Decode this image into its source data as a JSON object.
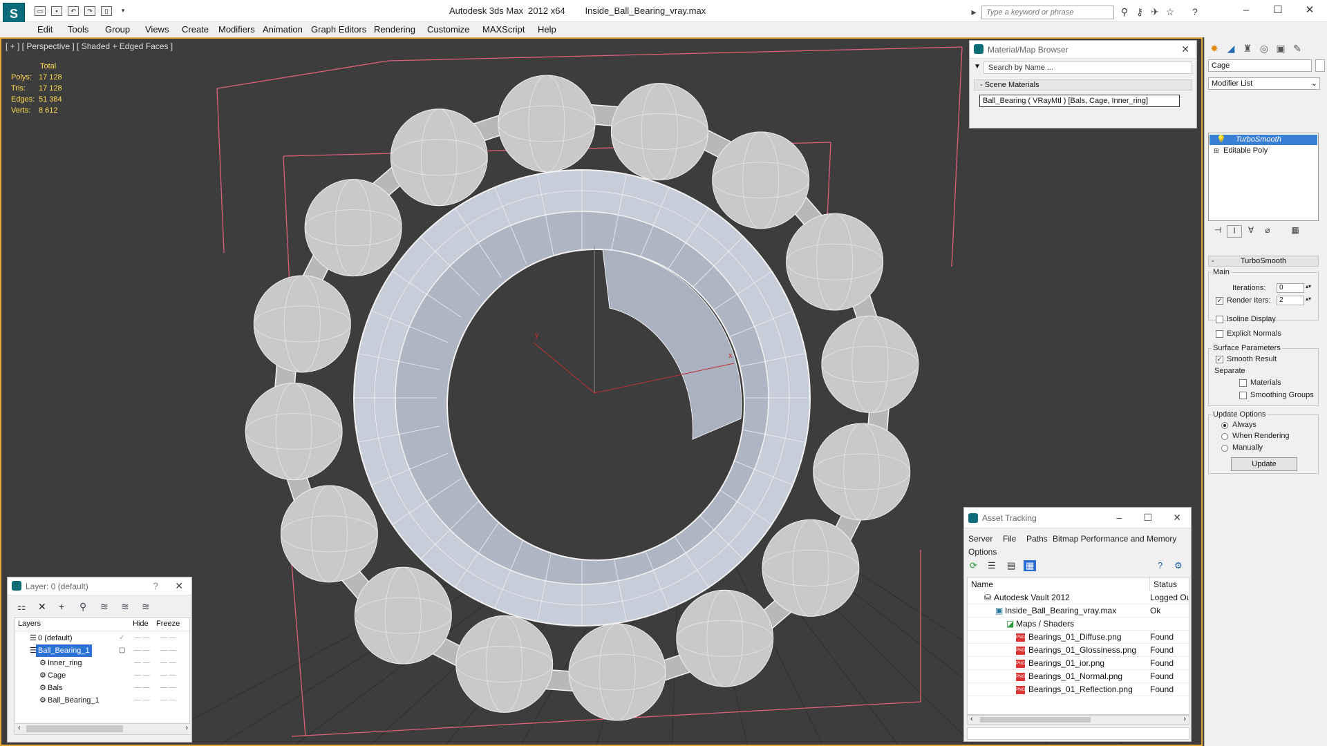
{
  "window": {
    "title": "Autodesk 3ds Max  2012 x64        Inside_Ball_Bearing_vray.max",
    "search_placeholder": "Type a keyword or phrase",
    "app_logo": "S"
  },
  "menu": [
    "Edit",
    "Tools",
    "Group",
    "Views",
    "Create",
    "Modifiers",
    "Animation",
    "Graph Editors",
    "Rendering",
    "Customize",
    "MAXScript",
    "Help"
  ],
  "viewport": {
    "label": "[ + ] [ Perspective ] [ Shaded + Edged Faces ]",
    "stats": {
      "header": "Total",
      "rows": [
        {
          "label": "Polys:",
          "value": "17 128"
        },
        {
          "label": "Tris:",
          "value": "17 128"
        },
        {
          "label": "Edges:",
          "value": "51 384"
        },
        {
          "label": "Verts:",
          "value": "8 612"
        }
      ]
    },
    "axis_labels": {
      "y": "y",
      "x": "x"
    },
    "colors": {
      "background": "#3d3d3d",
      "border": "#e7a83a",
      "bounds": "#e0607a",
      "mesh": "#c7cdd9",
      "balls": "#c9c9c9"
    }
  },
  "material_browser": {
    "title": "Material/Map Browser",
    "search_placeholder": "Search by Name ...",
    "section": "- Scene Materials",
    "entry": "Ball_Bearing  ( VRayMtl )  [Bals, Cage, Inner_ring]"
  },
  "command_panel": {
    "object_name": "Cage",
    "modifier_list": "Modifier List",
    "stack": [
      "TurboSmooth",
      "Editable Poly"
    ],
    "rollout": "TurboSmooth",
    "main_group": "Main",
    "iterations_label": "Iterations:",
    "iterations_value": "0",
    "render_iters_label": "Render Iters:",
    "render_iters_value": "2",
    "isoline": "Isoline Display",
    "explicit": "Explicit Normals",
    "surface_group": "Surface Parameters",
    "smooth_result": "Smooth Result",
    "separate": "Separate",
    "materials": "Materials",
    "smoothing_groups": "Smoothing Groups",
    "update_group": "Update Options",
    "always": "Always",
    "when_rendering": "When Rendering",
    "manually": "Manually",
    "update_button": "Update"
  },
  "layer_panel": {
    "title": "Layer: 0 (default)",
    "help": "?",
    "columns": [
      "Layers",
      "Hide",
      "Freeze"
    ],
    "rows": [
      {
        "name": "0 (default)",
        "indent": 1
      },
      {
        "name": "Ball_Bearing_1",
        "indent": 1
      },
      {
        "name": "Inner_ring",
        "indent": 2
      },
      {
        "name": "Cage",
        "indent": 2
      },
      {
        "name": "Bals",
        "indent": 2
      },
      {
        "name": "Ball_Bearing_1",
        "indent": 2
      }
    ]
  },
  "asset_tracking": {
    "title": "Asset Tracking",
    "menu": [
      "Server",
      "File",
      "Paths",
      "Bitmap Performance and Memory",
      "Options"
    ],
    "columns": [
      "Name",
      "Status"
    ],
    "rows": [
      {
        "name": "Autodesk Vault 2012",
        "status": "Logged Ou"
      },
      {
        "name": "Inside_Ball_Bearing_vray.max",
        "status": "Ok"
      },
      {
        "name": "Maps / Shaders",
        "status": ""
      },
      {
        "name": "Bearings_01_Diffuse.png",
        "status": "Found"
      },
      {
        "name": "Bearings_01_Glossiness.png",
        "status": "Found"
      },
      {
        "name": "Bearings_01_ior.png",
        "status": "Found"
      },
      {
        "name": "Bearings_01_Normal.png",
        "status": "Found"
      },
      {
        "name": "Bearings_01_Reflection.png",
        "status": "Found"
      }
    ]
  }
}
